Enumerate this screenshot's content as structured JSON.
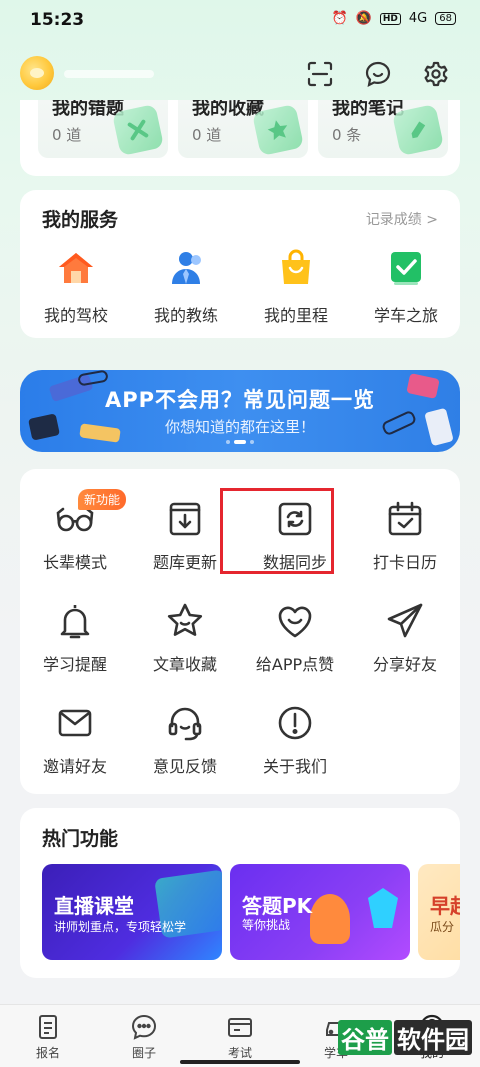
{
  "status_bar": {
    "time": "15:23",
    "signal": "4G",
    "hd": "HD",
    "battery": "68"
  },
  "records": [
    {
      "title": "我的错题",
      "count": "0 道",
      "icon": "x-mark-icon"
    },
    {
      "title": "我的收藏",
      "count": "0 道",
      "icon": "star-icon"
    },
    {
      "title": "我的笔记",
      "count": "0 条",
      "icon": "pencil-icon"
    }
  ],
  "services": {
    "title": "我的服务",
    "more": "记录成绩 >",
    "items": [
      {
        "label": "我的驾校",
        "icon": "school-house-icon",
        "color": "#ff7a3d"
      },
      {
        "label": "我的教练",
        "icon": "coach-icon",
        "color": "#2f7fe6"
      },
      {
        "label": "我的里程",
        "icon": "shopping-bag-icon",
        "color": "#ffc21a"
      },
      {
        "label": "学车之旅",
        "icon": "check-flag-icon",
        "color": "#22c066"
      }
    ]
  },
  "banner": {
    "title": "APP不会用？常见问题一览",
    "subtitle": "你想知道的都在这里！"
  },
  "tools": {
    "badge": "新功能",
    "items": [
      {
        "label": "长辈模式",
        "icon": "glasses-icon"
      },
      {
        "label": "题库更新",
        "icon": "download-box-icon"
      },
      {
        "label": "数据同步",
        "icon": "sync-icon"
      },
      {
        "label": "打卡日历",
        "icon": "calendar-check-icon"
      },
      {
        "label": "学习提醒",
        "icon": "bell-icon"
      },
      {
        "label": "文章收藏",
        "icon": "star-face-icon"
      },
      {
        "label": "给APP点赞",
        "icon": "heart-smile-icon"
      },
      {
        "label": "分享好友",
        "icon": "paper-plane-icon"
      },
      {
        "label": "邀请好友",
        "icon": "envelope-icon"
      },
      {
        "label": "意见反馈",
        "icon": "headset-icon"
      },
      {
        "label": "关于我们",
        "icon": "info-circle-icon"
      }
    ]
  },
  "hot": {
    "title": "热门功能",
    "items": [
      {
        "title": "直播课堂",
        "subtitle": "讲师划重点，专项轻松学"
      },
      {
        "title": "答题PK",
        "subtitle": "等你挑战"
      },
      {
        "title": "早起",
        "subtitle": "瓜分"
      }
    ]
  },
  "tabbar": [
    {
      "label": "报名",
      "icon": "document-icon"
    },
    {
      "label": "圈子",
      "icon": "chat-bubble-icon"
    },
    {
      "label": "考试",
      "icon": "card-icon"
    },
    {
      "label": "学车",
      "icon": "car-icon"
    },
    {
      "label": "我的",
      "icon": "profile-icon"
    }
  ],
  "watermark": {
    "part1": "谷普",
    "part2": "软件园"
  }
}
